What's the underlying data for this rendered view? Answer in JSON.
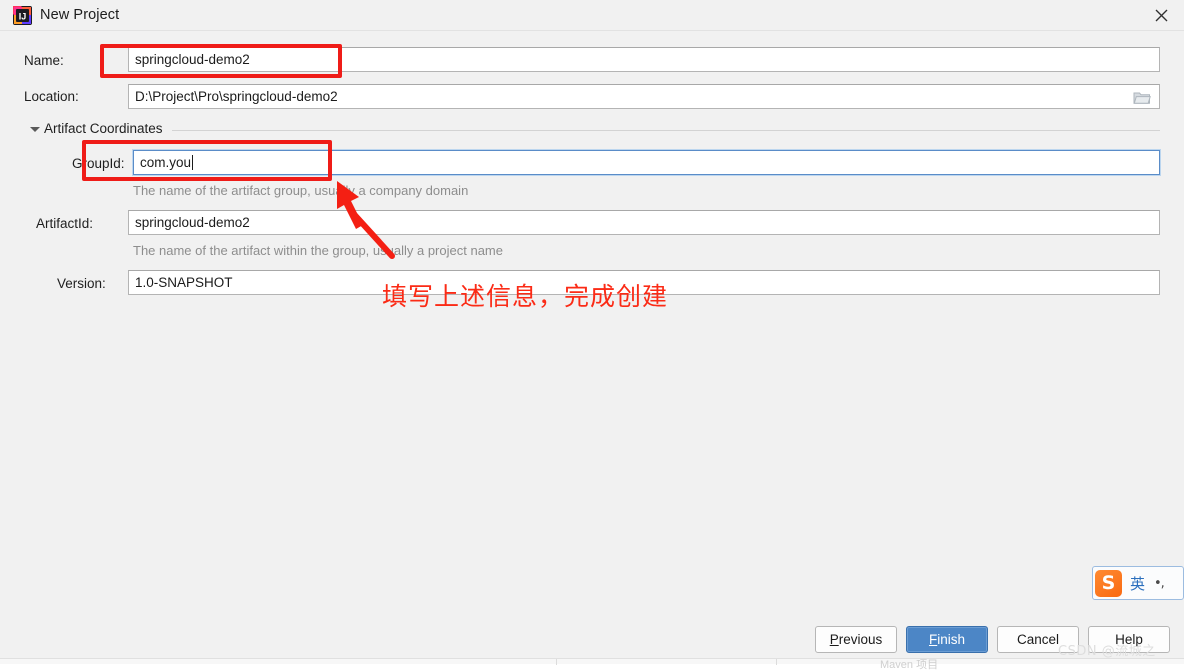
{
  "window": {
    "title": "New Project",
    "app_icon": "intellij-idea-icon",
    "close_label": "✕"
  },
  "form": {
    "name": {
      "label": "Name:",
      "value": "springcloud-demo2"
    },
    "location": {
      "label": "Location:",
      "value": "D:\\Project\\Pro\\springcloud-demo2",
      "browse_icon": "folder-icon"
    },
    "section": {
      "label": "Artifact Coordinates",
      "expanded_icon": "triangle-down-icon"
    },
    "group_id": {
      "label": "GroupId:",
      "value": "com.you",
      "hint": "The name of the artifact group, usually a company domain"
    },
    "artifact_id": {
      "label": "ArtifactId:",
      "value": "springcloud-demo2",
      "hint": "The name of the artifact within the group, usually a project name"
    },
    "version": {
      "label": "Version:",
      "value": "1.0-SNAPSHOT"
    }
  },
  "annotations": {
    "note_text": "填写上述信息，完成创建",
    "highlight_color": "#ef1c18",
    "note_color": "#fb2b16"
  },
  "ime": {
    "logo_letter": "S",
    "mode": "英",
    "punctuation": "•,"
  },
  "buttons": {
    "previous": {
      "prefix": "",
      "mnemonic": "P",
      "suffix": "revious"
    },
    "finish": {
      "prefix": "",
      "mnemonic": "F",
      "suffix": "inish"
    },
    "cancel": {
      "label": "Cancel"
    },
    "help": {
      "label": "Help"
    }
  },
  "watermark": {
    "text": "CSDN @流城之"
  },
  "behind_window": {
    "text": "Maven 项目"
  },
  "colors": {
    "dialog_bg": "#f1f1f1",
    "primary_button": "#4c86c6",
    "focus_border": "#5a8cc8",
    "annotation_red": "#ef1c18"
  }
}
